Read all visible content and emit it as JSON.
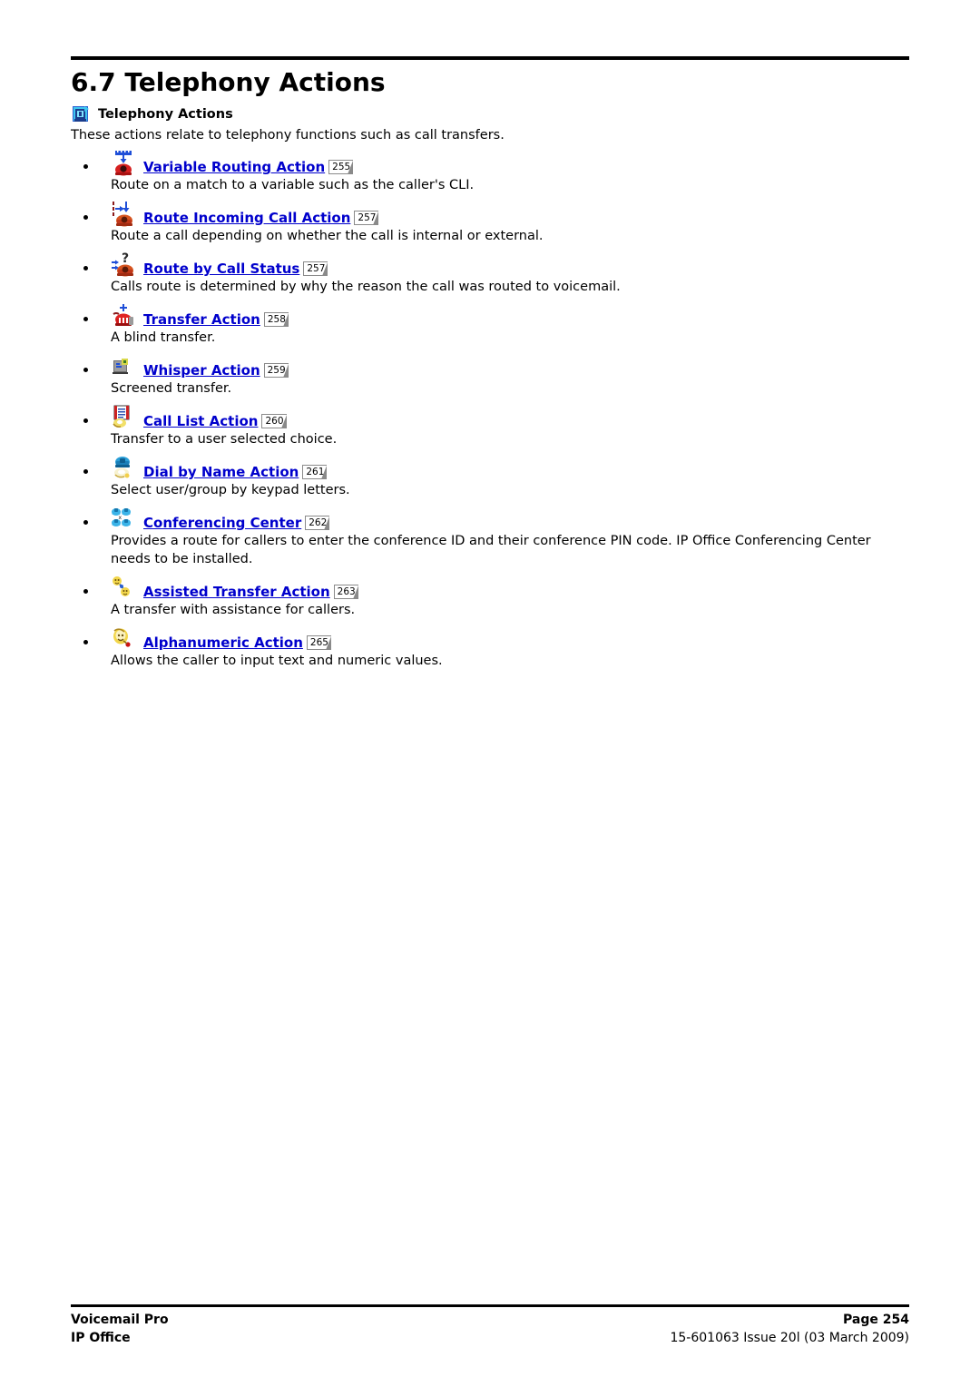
{
  "document": {
    "chapter_number": "6.7",
    "chapter_title": "6.7 Telephony Actions",
    "section_heading": "Telephony Actions",
    "section_heading_icon": "telephone-blue-icon",
    "intro_text": "These actions relate to telephony functions such as call transfers."
  },
  "items": [
    {
      "icon": "ruler-arrow-red-telephone-icon",
      "link": "Variable Routing Action",
      "page_ref": "255",
      "description": "Route on a match to a variable such as the caller's CLI."
    },
    {
      "icon": "arrows-red-telephone-icon",
      "link": "Route Incoming Call Action",
      "page_ref": "257",
      "description": "Route a call depending on whether the call is internal or external."
    },
    {
      "icon": "question-arrows-red-telephone-icon",
      "link": "Route by Call Status",
      "page_ref": "257",
      "description": "Calls route is determined by why the reason the call was routed to voicemail."
    },
    {
      "icon": "red-telephone-transfer-icon",
      "link": "Transfer Action",
      "page_ref": "258",
      "description": "A blind transfer."
    },
    {
      "icon": "monitor-whisper-icon",
      "link": "Whisper Action",
      "page_ref": "259",
      "description": "Screened transfer."
    },
    {
      "icon": "call-list-book-icon",
      "link": "Call List Action",
      "page_ref": "260",
      "description": "Transfer to a user selected choice."
    },
    {
      "icon": "dial-by-name-handset-icon",
      "link": "Dial by Name Action",
      "page_ref": "261",
      "description": "Select user/group by keypad letters."
    },
    {
      "icon": "conferencing-four-phones-icon",
      "link": "Conferencing Center",
      "page_ref": "262",
      "description": "Provides a route for callers to enter the conference ID and their conference PIN code. IP Office Conferencing Center needs to be installed."
    },
    {
      "icon": "assisted-transfer-two-faces-icon",
      "link": "Assisted Transfer Action",
      "page_ref": "263",
      "description": "A transfer with assistance for callers."
    },
    {
      "icon": "alphanumeric-face-icon",
      "link": "Alphanumeric Action",
      "page_ref": "265",
      "description": "Allows the caller to input text and numeric values."
    }
  ],
  "footer": {
    "product_name": "Voicemail Pro",
    "product_line": "IP Office",
    "page_label": "Page 254",
    "doc_reference": "15-601063 Issue 20l (03 March 2009)"
  },
  "colors": {
    "link": "#0000cc",
    "text": "#000000",
    "rule": "#000000",
    "icon_red": "#d62020",
    "icon_blue": "#1f4fd8",
    "icon_cyan": "#3ec6f0",
    "icon_yellow": "#f2d64b"
  }
}
